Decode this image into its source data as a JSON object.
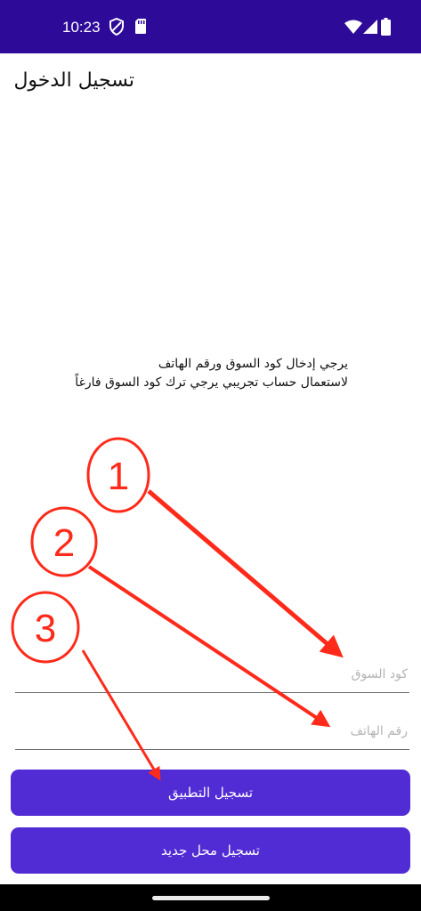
{
  "status_bar": {
    "time": "10:23",
    "left_icons": [
      "shield-icon",
      "sim-card-icon"
    ],
    "right_icons": [
      "wifi-icon",
      "signal-icon",
      "battery-icon"
    ]
  },
  "app_bar": {
    "title": "تسجيل الدخول"
  },
  "instructions": {
    "line1": "يرجي إدخال كود السوق ورقم الهاتف",
    "line2": "لاستعمال حساب تجريبي يرجي ترك كود السوق فارغاً"
  },
  "form": {
    "market_code_placeholder": "كود السوق",
    "market_code_value": "",
    "phone_placeholder": "رقم الهاتف",
    "phone_value": ""
  },
  "buttons": {
    "login_label": "تسجيل التطبيق",
    "register_label": "تسجيل محل جديد"
  },
  "annotations": [
    {
      "label": "1",
      "target": "market-code-input"
    },
    {
      "label": "2",
      "target": "phone-input"
    },
    {
      "label": "3",
      "target": "login-button"
    }
  ],
  "colors": {
    "status_bar": "#2e0a99",
    "button": "#512bd4",
    "annotation": "#ff2a1a"
  }
}
